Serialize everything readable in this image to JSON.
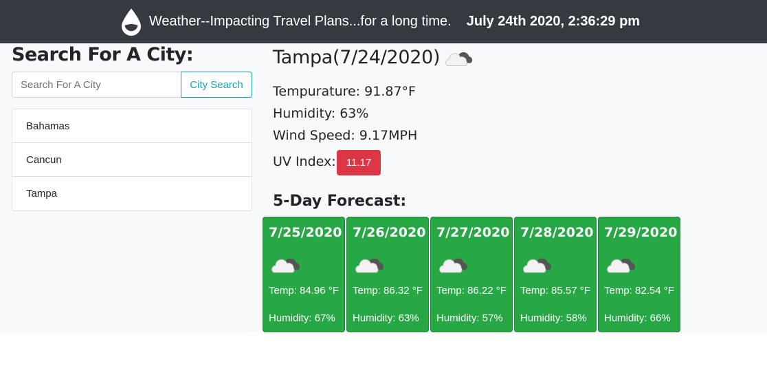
{
  "header": {
    "title": "Weather--Impacting Travel Plans...for a long time.",
    "datetime": "July 24th 2020, 2:36:29 pm",
    "icon": "water-drop-icon"
  },
  "search": {
    "heading": "Search For A City:",
    "placeholder": "Search For A City",
    "button_label": "City Search"
  },
  "history": [
    "Bahamas",
    "Cancun",
    "Tampa"
  ],
  "current": {
    "title": "Tampa(7/24/2020)",
    "icon": "cloud-icon",
    "temperature": "Tempurature: 91.87°F",
    "humidity": "Humidity: 63%",
    "wind": "Wind Speed: 9.17MPH",
    "uv_label": "UV Index:",
    "uv_value": "11.17",
    "uv_color": "#dc3545"
  },
  "forecast": {
    "heading": "5-Day Forecast:",
    "card_color": "#28a745",
    "days": [
      {
        "date": "7/25/2020",
        "temp": "Temp: 84.96 °F",
        "humidity": "Humidity: 67%",
        "icon": "cloud-icon"
      },
      {
        "date": "7/26/2020",
        "temp": "Temp: 86.32 °F",
        "humidity": "Humidity: 63%",
        "icon": "cloud-icon"
      },
      {
        "date": "7/27/2020",
        "temp": "Temp: 86.22 °F",
        "humidity": "Humidity: 57%",
        "icon": "cloud-icon"
      },
      {
        "date": "7/28/2020",
        "temp": "Temp: 85.57 °F",
        "humidity": "Humidity: 58%",
        "icon": "cloud-icon"
      },
      {
        "date": "7/29/2020",
        "temp": "Temp: 82.54 °F",
        "humidity": "Humidity: 66%",
        "icon": "cloud-icon"
      }
    ]
  }
}
